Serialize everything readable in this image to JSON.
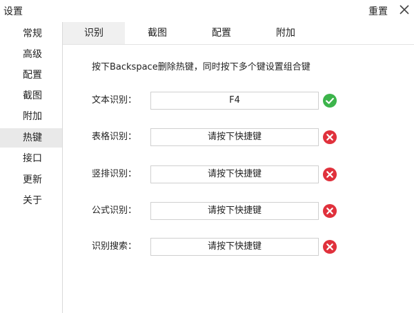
{
  "window": {
    "title": "设置",
    "reset_label": "重置"
  },
  "sidebar": {
    "items": [
      {
        "label": "常规"
      },
      {
        "label": "高级"
      },
      {
        "label": "配置"
      },
      {
        "label": "截图"
      },
      {
        "label": "附加"
      },
      {
        "label": "热键",
        "active": true
      },
      {
        "label": "接口"
      },
      {
        "label": "更新"
      },
      {
        "label": "关于"
      }
    ]
  },
  "tabs": [
    {
      "label": "识别",
      "active": true
    },
    {
      "label": "截图"
    },
    {
      "label": "配置"
    },
    {
      "label": "附加"
    }
  ],
  "hint": "按下Backspace删除热键，同时按下多个键设置组合键",
  "hotkeys": [
    {
      "label": "文本识别：",
      "value": "F4",
      "status": "ok"
    },
    {
      "label": "表格识别：",
      "value": "请按下快捷键",
      "status": "error"
    },
    {
      "label": "竖排识别：",
      "value": "请按下快捷键",
      "status": "error"
    },
    {
      "label": "公式识别：",
      "value": "请按下快捷键",
      "status": "error"
    },
    {
      "label": "识别搜索：",
      "value": "请按下快捷键",
      "status": "error"
    }
  ],
  "colors": {
    "ok": "#3cb44b",
    "error": "#e0313c"
  },
  "icons": {
    "ok": "check-circle-icon",
    "error": "x-circle-icon"
  }
}
